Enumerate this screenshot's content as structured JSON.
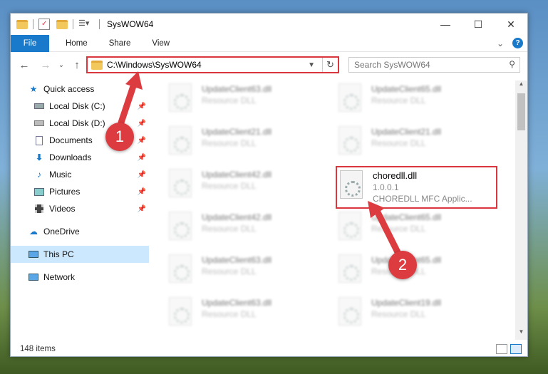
{
  "window": {
    "title": "SysWOW64",
    "controls": [
      "—",
      "☐",
      "✕"
    ]
  },
  "ribbon": {
    "tabs": [
      "File",
      "Home",
      "Share",
      "View"
    ],
    "collapse": "⌄",
    "help": "?"
  },
  "nav": {
    "back": "←",
    "forward": "→",
    "recent": "⌄",
    "up": "↑"
  },
  "address": {
    "path": "C:\\Windows\\SysWOW64",
    "refresh": "↻"
  },
  "search": {
    "placeholder": "Search SysWOW64"
  },
  "sidebar": {
    "quick_access": "Quick access",
    "items": [
      {
        "label": "Local Disk (C:)",
        "icon": "drive-icon"
      },
      {
        "label": "Local Disk (D:)",
        "icon": "drive-icon"
      },
      {
        "label": "Documents",
        "icon": "documents-icon"
      },
      {
        "label": "Downloads",
        "icon": "downloads-icon"
      },
      {
        "label": "Music",
        "icon": "music-icon"
      },
      {
        "label": "Pictures",
        "icon": "pictures-icon"
      },
      {
        "label": "Videos",
        "icon": "videos-icon"
      }
    ],
    "onedrive": "OneDrive",
    "this_pc": "This PC",
    "network": "Network"
  },
  "files": {
    "blurred": [
      {
        "name": "UpdateClient63.dll",
        "type": "Resource DLL"
      },
      {
        "name": "UpdateClient65.dll",
        "type": "Resource DLL"
      },
      {
        "name": "UpdateClient21.dll",
        "type": "Resource DLL"
      },
      {
        "name": "UpdateClient21.dll",
        "type": "Resource DLL"
      },
      {
        "name": "UpdateClient42.dll",
        "type": "Resource DLL"
      },
      {
        "name": "UpdateClient42.dll",
        "type": "Resource DLL"
      },
      {
        "name": "UpdateClient65.dll",
        "type": "Resource DLL"
      },
      {
        "name": "UpdateClient63.dll",
        "type": "Resource DLL"
      },
      {
        "name": "UpdateClient65.dll",
        "type": "Resource DLL"
      },
      {
        "name": "UpdateClient63.dll",
        "type": "Resource DLL"
      },
      {
        "name": "UpdateClient19.dll",
        "type": "Resource DLL"
      }
    ],
    "highlighted": {
      "name": "choredll.dll",
      "version": "1.0.0.1",
      "description": "CHOREDLL MFC Applic..."
    }
  },
  "status": {
    "count": "148 items"
  },
  "callouts": [
    "1",
    "2"
  ],
  "colors": {
    "accent": "#1979ca",
    "highlight": "#d9363e",
    "callout": "#dc3b40"
  }
}
